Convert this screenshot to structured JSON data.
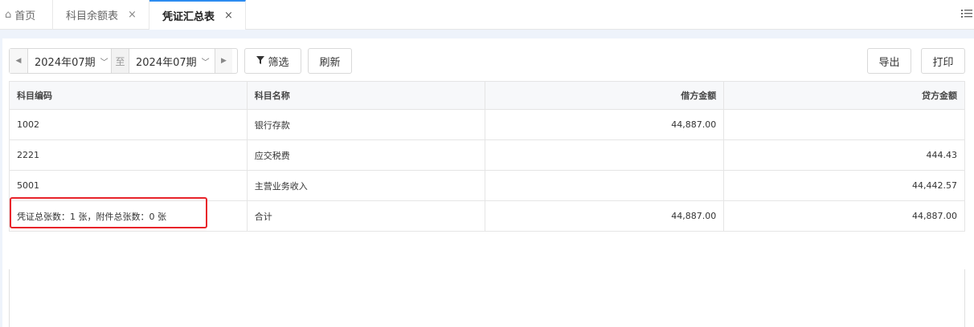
{
  "tabs": {
    "home": "首页",
    "subject_balance": "科目余额表",
    "voucher_summary": "凭证汇总表",
    "close_symbol": "×"
  },
  "toolbar": {
    "period_start": "2024年07期",
    "period_to": "至",
    "period_end": "2024年07期",
    "filter_label": "筛选",
    "refresh_label": "刷新",
    "export_label": "导出",
    "print_label": "打印"
  },
  "table": {
    "headers": [
      "科目编码",
      "科目名称",
      "借方金额",
      "贷方金额"
    ],
    "rows": [
      {
        "code": "1002",
        "name": "银行存款",
        "debit": "44,887.00",
        "credit": ""
      },
      {
        "code": "2221",
        "name": "应交税费",
        "debit": "",
        "credit": "444.43"
      },
      {
        "code": "5001",
        "name": "主营业务收入",
        "debit": "",
        "credit": "44,442.57"
      }
    ],
    "total": {
      "code": "凭证总张数：1 张，附件总张数：0 张",
      "name": "合计",
      "debit": "44,887.00",
      "credit": "44,887.00"
    }
  },
  "colors": {
    "accent": "#2d8cf0",
    "highlight": "#e8232a"
  }
}
